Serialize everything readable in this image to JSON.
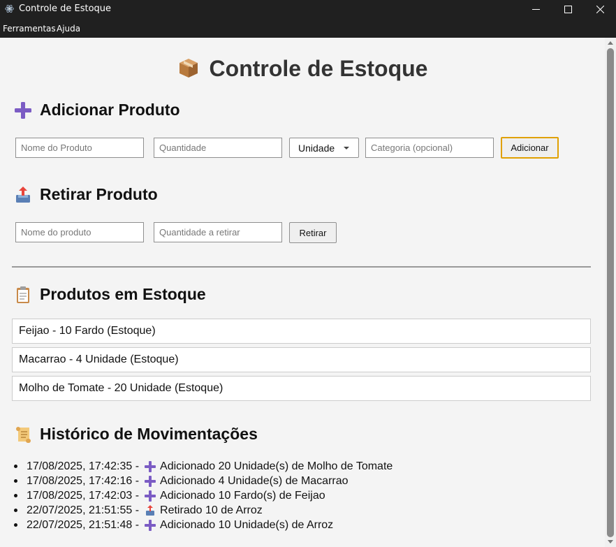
{
  "window": {
    "title": "Controle de Estoque"
  },
  "menu": {
    "items": [
      "Ferramentas",
      "Ajuda"
    ]
  },
  "page": {
    "title": "Controle de Estoque"
  },
  "add_section": {
    "title": "Adicionar Produto",
    "name_placeholder": "Nome do Produto",
    "qty_placeholder": "Quantidade",
    "unit_selected": "Unidade",
    "category_placeholder": "Categoria (opcional)",
    "button": "Adicionar"
  },
  "remove_section": {
    "title": "Retirar Produto",
    "name_placeholder": "Nome do produto",
    "qty_placeholder": "Quantidade a retirar",
    "button": "Retirar"
  },
  "stock_section": {
    "title": "Produtos em Estoque",
    "items": [
      "Feijao - 10 Fardo (Estoque)",
      "Macarrao - 4 Unidade (Estoque)",
      "Molho de Tomate - 20 Unidade (Estoque)"
    ]
  },
  "history_section": {
    "title": "Histórico de Movimentações",
    "entries": [
      {
        "timestamp": "17/08/2025, 17:42:35 -",
        "type": "add",
        "text": "Adicionado 20 Unidade(s) de Molho de Tomate"
      },
      {
        "timestamp": "17/08/2025, 17:42:16 -",
        "type": "add",
        "text": "Adicionado 4 Unidade(s) de Macarrao"
      },
      {
        "timestamp": "17/08/2025, 17:42:03 -",
        "type": "add",
        "text": "Adicionado 10 Fardo(s) de Feijao"
      },
      {
        "timestamp": "22/07/2025, 21:51:55 -",
        "type": "remove",
        "text": "Retirado 10 de Arroz"
      },
      {
        "timestamp": "22/07/2025, 21:51:48 -",
        "type": "add",
        "text": "Adicionado 10 Unidade(s) de Arroz"
      }
    ]
  },
  "colors": {
    "accent": "#e0a000",
    "plus_icon": "#7b5cc4",
    "titlebar": "#202020"
  }
}
